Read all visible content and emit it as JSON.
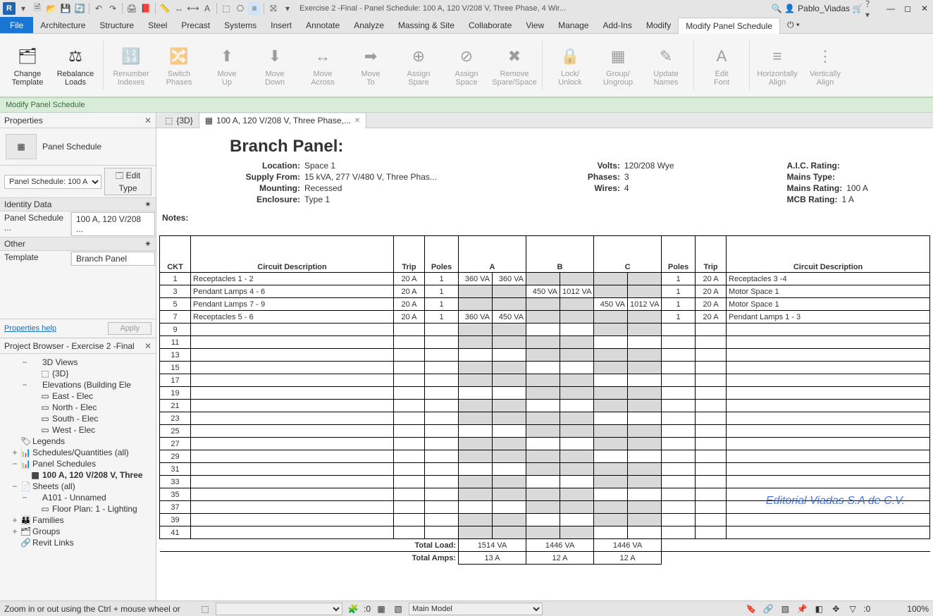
{
  "titlebar": {
    "doc_title": "Exercise 2 -Final - Panel Schedule: 100 A, 120 V/208 V, Three Phase, 4 Wir...",
    "user": "Pablo_Viadas"
  },
  "menubar": {
    "items": [
      "File",
      "Architecture",
      "Structure",
      "Steel",
      "Precast",
      "Systems",
      "Insert",
      "Annotate",
      "Analyze",
      "Massing & Site",
      "Collaborate",
      "View",
      "Manage",
      "Add-Ins",
      "Modify",
      "Modify Panel Schedule"
    ],
    "active": "Modify Panel Schedule"
  },
  "ribbon": {
    "buttons": [
      {
        "label": "Change\nTemplate",
        "icon": "🗂",
        "enabled": true
      },
      {
        "label": "Rebalance\nLoads",
        "icon": "⚖",
        "enabled": true
      },
      {
        "label": "Renumber\nIndexes",
        "icon": "🔢",
        "enabled": false
      },
      {
        "label": "Switch\nPhases",
        "icon": "🔀",
        "enabled": false
      },
      {
        "label": "Move\nUp",
        "icon": "⬆",
        "enabled": false
      },
      {
        "label": "Move\nDown",
        "icon": "⬇",
        "enabled": false
      },
      {
        "label": "Move\nAcross",
        "icon": "↔",
        "enabled": false
      },
      {
        "label": "Move\nTo",
        "icon": "➡",
        "enabled": false
      },
      {
        "label": "Assign\nSpare",
        "icon": "⊕",
        "enabled": false
      },
      {
        "label": "Assign\nSpace",
        "icon": "⊘",
        "enabled": false
      },
      {
        "label": "Remove\nSpare/Space",
        "icon": "✖",
        "enabled": false
      },
      {
        "label": "Lock/\nUnlock",
        "icon": "🔒",
        "enabled": false
      },
      {
        "label": "Group/\nUngroup",
        "icon": "▦",
        "enabled": false
      },
      {
        "label": "Update\nNames",
        "icon": "✎",
        "enabled": false
      },
      {
        "label": "Edit\nFont",
        "icon": "A",
        "enabled": false
      },
      {
        "label": "Horizontally\nAlign",
        "icon": "≡",
        "enabled": false
      },
      {
        "label": "Vertically\nAlign",
        "icon": "⋮",
        "enabled": false
      }
    ]
  },
  "context_bar": "Modify Panel Schedule",
  "properties": {
    "title": "Properties",
    "type_name": "Panel Schedule",
    "instance_sel": "Panel Schedule: 100 A",
    "edit_type": "Edit Type",
    "sections": [
      {
        "name": "Identity Data",
        "rows": [
          {
            "k": "Panel Schedule ...",
            "v": "100 A, 120 V/208 ..."
          }
        ]
      },
      {
        "name": "Other",
        "rows": [
          {
            "k": "Template",
            "v": "Branch Panel"
          }
        ]
      }
    ],
    "help": "Properties help",
    "apply": "Apply"
  },
  "browser": {
    "title": "Project Browser - Exercise 2 -Final",
    "nodes": [
      {
        "d": 2,
        "exp": "−",
        "icon": "",
        "label": "3D Views"
      },
      {
        "d": 3,
        "exp": "",
        "icon": "⬚",
        "label": "{3D}"
      },
      {
        "d": 2,
        "exp": "−",
        "icon": "",
        "label": "Elevations (Building Ele"
      },
      {
        "d": 3,
        "exp": "",
        "icon": "▭",
        "label": "East - Elec"
      },
      {
        "d": 3,
        "exp": "",
        "icon": "▭",
        "label": "North - Elec"
      },
      {
        "d": 3,
        "exp": "",
        "icon": "▭",
        "label": "South - Elec"
      },
      {
        "d": 3,
        "exp": "",
        "icon": "▭",
        "label": "West - Elec"
      },
      {
        "d": 1,
        "exp": "",
        "icon": "🏷",
        "label": "Legends"
      },
      {
        "d": 1,
        "exp": "+",
        "icon": "📊",
        "label": "Schedules/Quantities (all)"
      },
      {
        "d": 1,
        "exp": "−",
        "icon": "📊",
        "label": "Panel Schedules"
      },
      {
        "d": 2,
        "exp": "",
        "icon": "▦",
        "label": "100 A, 120 V/208 V, Three",
        "bold": true
      },
      {
        "d": 1,
        "exp": "−",
        "icon": "📄",
        "label": "Sheets (all)"
      },
      {
        "d": 2,
        "exp": "−",
        "icon": "",
        "label": "A101 - Unnamed"
      },
      {
        "d": 3,
        "exp": "",
        "icon": "▭",
        "label": "Floor Plan: 1 - Lighting"
      },
      {
        "d": 1,
        "exp": "+",
        "icon": "👪",
        "label": "Families"
      },
      {
        "d": 1,
        "exp": "+",
        "icon": "🗂",
        "label": "Groups"
      },
      {
        "d": 1,
        "exp": "",
        "icon": "🔗",
        "label": "Revit Links"
      }
    ]
  },
  "tabs": [
    {
      "icon": "⬚",
      "label": "{3D}",
      "active": false,
      "closable": false
    },
    {
      "icon": "▦",
      "label": "100 A, 120 V/208 V, Three Phase,...",
      "active": true,
      "closable": true
    }
  ],
  "panel": {
    "title": "Branch Panel:",
    "left": [
      {
        "lab": "Location:",
        "val": "Space 1"
      },
      {
        "lab": "Supply From:",
        "val": "15 kVA, 277 V/480 V, Three Phas..."
      },
      {
        "lab": "Mounting:",
        "val": "Recessed"
      },
      {
        "lab": "Enclosure:",
        "val": "Type 1"
      }
    ],
    "mid": [
      {
        "lab": "Volts:",
        "val": "120/208 Wye"
      },
      {
        "lab": "Phases:",
        "val": "3"
      },
      {
        "lab": "Wires:",
        "val": "4"
      }
    ],
    "right": [
      {
        "lab": "A.I.C. Rating:",
        "val": ""
      },
      {
        "lab": "Mains Type:",
        "val": ""
      },
      {
        "lab": "Mains Rating:",
        "val": "100 A"
      },
      {
        "lab": "MCB Rating:",
        "val": "1 A"
      }
    ],
    "notes": "Notes:"
  },
  "schedule": {
    "headers": [
      "CKT",
      "Circuit Description",
      "Trip",
      "Poles",
      "A",
      "",
      "B",
      "",
      "C",
      "",
      "Poles",
      "Trip",
      "Circuit Description"
    ],
    "rows": [
      {
        "ckt": "1",
        "desc": "Receptacles 1 - 2",
        "trip": "20 A",
        "poles": "1",
        "a1": "360 VA",
        "a2": "360 VA",
        "b1": "",
        "b2": "",
        "c1": "",
        "c2": "",
        "poles2": "1",
        "trip2": "20 A",
        "desc2": "Receptacles 3 -4"
      },
      {
        "ckt": "3",
        "desc": "Pendant Lamps 4 - 6",
        "trip": "20 A",
        "poles": "1",
        "a1": "",
        "a2": "",
        "b1": "450 VA",
        "b2": "1012 VA",
        "c1": "",
        "c2": "",
        "poles2": "1",
        "trip2": "20 A",
        "desc2": "Motor Space 1"
      },
      {
        "ckt": "5",
        "desc": "Pendant Lamps 7 - 9",
        "trip": "20 A",
        "poles": "1",
        "a1": "",
        "a2": "",
        "b1": "",
        "b2": "",
        "c1": "450 VA",
        "c2": "1012 VA",
        "poles2": "1",
        "trip2": "20 A",
        "desc2": "Motor Space 1"
      },
      {
        "ckt": "7",
        "desc": "Receptacles 5 - 6",
        "trip": "20 A",
        "poles": "1",
        "a1": "360 VA",
        "a2": "450 VA",
        "b1": "",
        "b2": "",
        "c1": "",
        "c2": "",
        "poles2": "1",
        "trip2": "20 A",
        "desc2": "Pendant Lamps 1 - 3"
      },
      {
        "ckt": "9"
      },
      {
        "ckt": "11"
      },
      {
        "ckt": "13"
      },
      {
        "ckt": "15"
      },
      {
        "ckt": "17"
      },
      {
        "ckt": "19"
      },
      {
        "ckt": "21"
      },
      {
        "ckt": "23"
      },
      {
        "ckt": "25"
      },
      {
        "ckt": "27"
      },
      {
        "ckt": "29"
      },
      {
        "ckt": "31"
      },
      {
        "ckt": "33"
      },
      {
        "ckt": "35"
      },
      {
        "ckt": "37"
      },
      {
        "ckt": "39"
      },
      {
        "ckt": "41"
      }
    ],
    "totals": {
      "load_label": "Total Load:",
      "load": {
        "a": "1514 VA",
        "b": "1446 VA",
        "c": "1446 VA"
      },
      "amps_label": "Total Amps:",
      "amps": {
        "a": "13 A",
        "b": "12 A",
        "c": "12 A"
      }
    }
  },
  "watermark": "Editorial Viadas S.A de C.V.",
  "statusbar": {
    "hint": "Zoom in or out using the Ctrl + mouse wheel or",
    "sel1_val": "",
    "scale": ":0",
    "model": "Main Model",
    "filter": ":0",
    "zoom": "100%"
  }
}
